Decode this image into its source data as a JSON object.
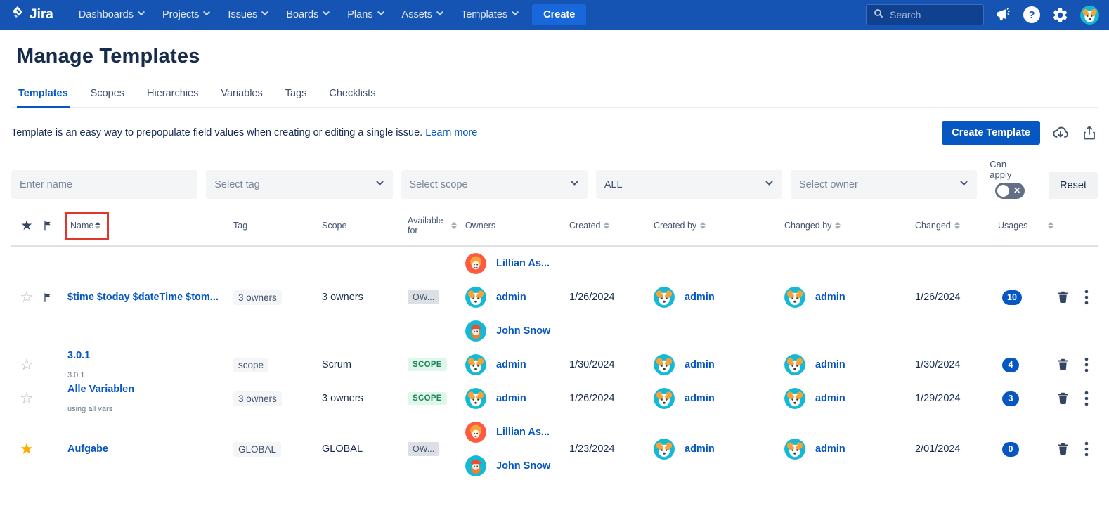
{
  "colors": {
    "navbar": "#1554B2",
    "nav_button": "#1868DB",
    "link_blue": "#0757C2",
    "text_dark": "#172B4D",
    "badge_gray_bg": "#F4F5F7",
    "scope_badge_bg": "#DFF7EA",
    "scope_badge_text": "#1F845A",
    "usage_pill_bg": "#0757C2",
    "toggle_off_bg": "#626F86",
    "annotation_red": "#E0362C",
    "avatar_cyan": "#14B9D6",
    "avatar_orange": "#FF5A3F",
    "star_yellow": "#FFAB00"
  },
  "icons": {
    "logo": "jira-mark",
    "nav_chevron": "chevron-down",
    "search": "magnifier",
    "announce": "megaphone",
    "help": "question-circle",
    "settings": "gear",
    "profile": "dog-avatar",
    "download": "cloud-download",
    "export": "share-up-arrow",
    "favorite": "star",
    "flag": "flag",
    "delete": "trash",
    "more": "kebab-dots",
    "toggle_off": "x-cross"
  },
  "nav": {
    "logo_text": "Jira",
    "items": [
      "Dashboards",
      "Projects",
      "Issues",
      "Boards",
      "Plans",
      "Assets",
      "Templates"
    ],
    "create_label": "Create",
    "search_placeholder": "Search"
  },
  "page": {
    "title": "Manage Templates",
    "tabs": [
      {
        "label": "Templates",
        "active": true
      },
      {
        "label": "Scopes",
        "active": false
      },
      {
        "label": "Hierarchies",
        "active": false
      },
      {
        "label": "Variables",
        "active": false
      },
      {
        "label": "Tags",
        "active": false
      },
      {
        "label": "Checklists",
        "active": false
      }
    ],
    "description": "Template is an easy way to prepopulate field values when creating or editing a single issue.",
    "learn_more_label": "Learn more",
    "create_template_label": "Create Template"
  },
  "filters": {
    "name_placeholder": "Enter name",
    "tag_placeholder": "Select tag",
    "scope_placeholder": "Select scope",
    "type_value": "ALL",
    "owner_placeholder": "Select owner",
    "can_apply_label": "Can apply",
    "reset_label": "Reset"
  },
  "table": {
    "headers": {
      "name": "Name",
      "tag": "Tag",
      "scope": "Scope",
      "available_for": "Available for",
      "owners": "Owners",
      "created": "Created",
      "created_by": "Created by",
      "changed_by": "Changed by",
      "changed": "Changed",
      "usages": "Usages"
    },
    "rows": [
      {
        "starred": false,
        "flagged": true,
        "name": "$time $today $dateTime $tom...",
        "subtitle": "",
        "tag": "3 owners",
        "scope": "3 owners",
        "available": "OW...",
        "available_type": "ow",
        "owners": [
          {
            "name": "Lillian As...",
            "avatar": "person-orange"
          },
          {
            "name": "admin",
            "avatar": "dog"
          },
          {
            "name": "John Snow",
            "avatar": "person-beard"
          }
        ],
        "created": "1/26/2024",
        "created_by": {
          "name": "admin",
          "avatar": "dog"
        },
        "changed_by": {
          "name": "admin",
          "avatar": "dog"
        },
        "changed": "1/26/2024",
        "usages": "10"
      },
      {
        "starred": false,
        "flagged": false,
        "name": "3.0.1",
        "subtitle": "3.0.1",
        "tag": "scope",
        "scope": "Scrum",
        "available": "SCOPE",
        "available_type": "scope",
        "owners": [
          {
            "name": "admin",
            "avatar": "dog"
          }
        ],
        "created": "1/30/2024",
        "created_by": {
          "name": "admin",
          "avatar": "dog"
        },
        "changed_by": {
          "name": "admin",
          "avatar": "dog"
        },
        "changed": "1/30/2024",
        "usages": "4"
      },
      {
        "starred": false,
        "flagged": false,
        "name": "Alle Variablen",
        "subtitle": "using all vars",
        "tag": "3 owners",
        "scope": "3 owners",
        "available": "SCOPE",
        "available_type": "scope",
        "owners": [
          {
            "name": "admin",
            "avatar": "dog"
          }
        ],
        "created": "1/26/2024",
        "created_by": {
          "name": "admin",
          "avatar": "dog"
        },
        "changed_by": {
          "name": "admin",
          "avatar": "dog"
        },
        "changed": "1/29/2024",
        "usages": "3"
      },
      {
        "starred": true,
        "flagged": false,
        "name": "Aufgabe",
        "subtitle": "",
        "tag": "GLOBAL",
        "scope": "GLOBAL",
        "available": "OW...",
        "available_type": "ow",
        "owners": [
          {
            "name": "Lillian As...",
            "avatar": "person-orange"
          },
          {
            "name": "John Snow",
            "avatar": "person-beard"
          }
        ],
        "created": "1/23/2024",
        "created_by": {
          "name": "admin",
          "avatar": "dog"
        },
        "changed_by": {
          "name": "admin",
          "avatar": "dog"
        },
        "changed": "2/01/2024",
        "usages": "0"
      }
    ]
  }
}
